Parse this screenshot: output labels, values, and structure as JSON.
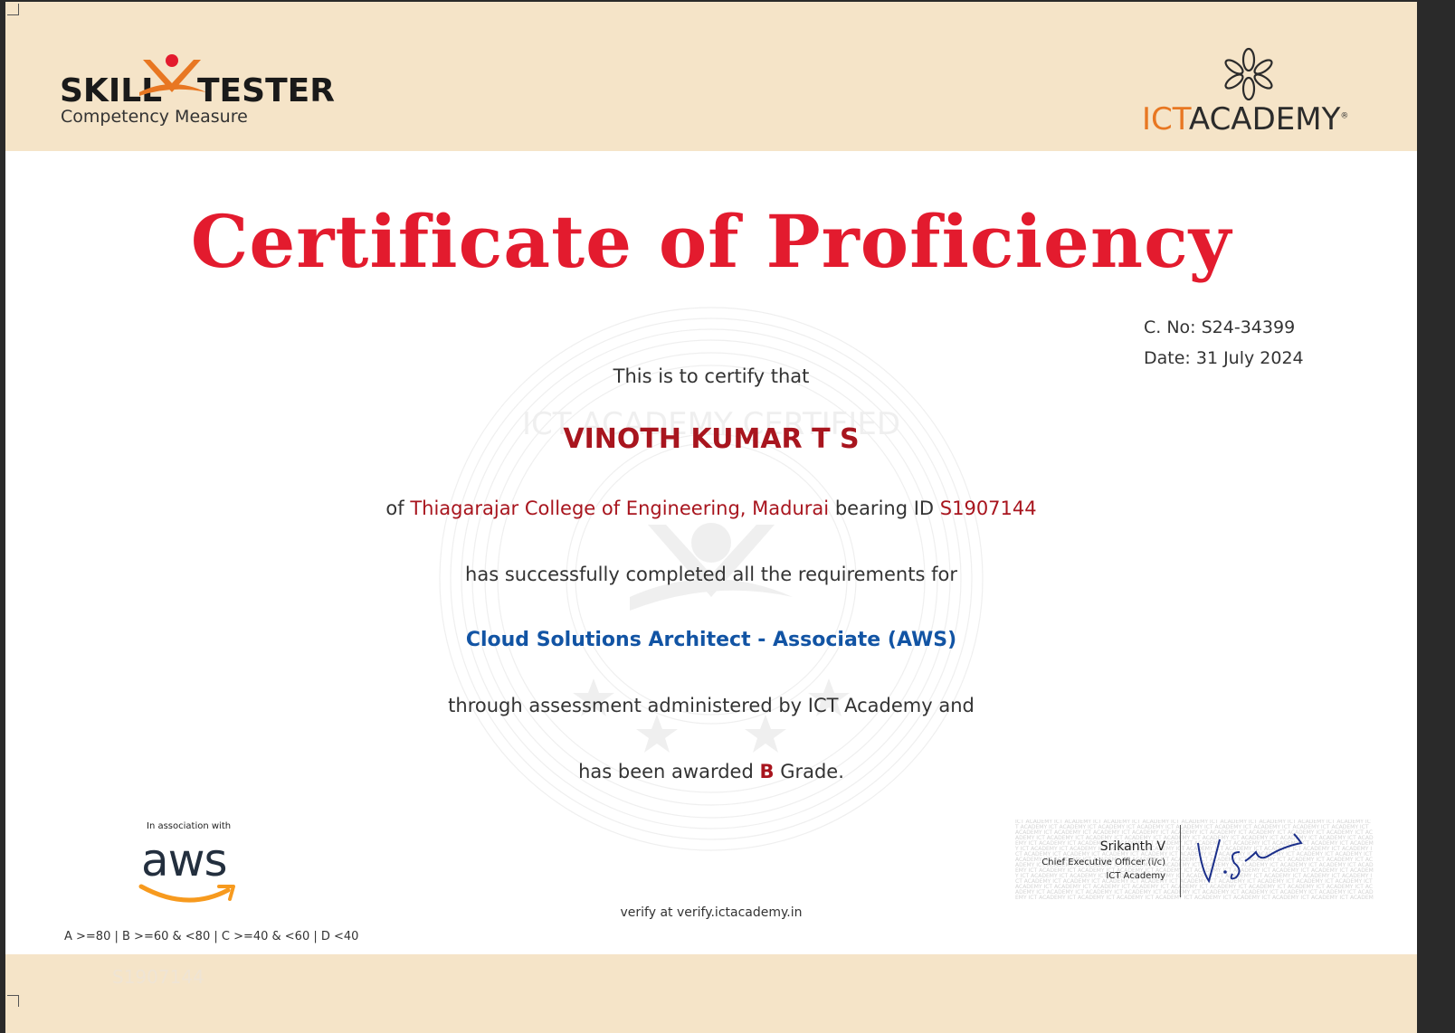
{
  "header": {
    "skill_tester": {
      "word_left": "SKILL",
      "word_right": "TESTER",
      "tagline": "Competency Measure",
      "brand_color": "#e87722"
    },
    "ict_academy": {
      "word_orange": "ICT",
      "word_dark": "ACADEMY",
      "registered": "®"
    }
  },
  "certificate": {
    "title": "Certificate of Proficiency",
    "certificate_no": "C. No: S24-34399",
    "date": "Date: 31 July 2024",
    "intro": "This is to certify that",
    "recipient_name": "VINOTH KUMAR T S",
    "of_prefix": "of",
    "institution": "Thiagarajar College of Engineering, Madurai",
    "bearing_id_label": "bearing ID",
    "student_id": "S1907144",
    "completed_text": "has successfully completed all the requirements for",
    "course": "Cloud Solutions Architect - Associate (AWS)",
    "assessment_text": "through assessment administered by ICT Academy and",
    "awarded_prefix": "has been awarded",
    "grade": "B",
    "awarded_suffix": "Grade."
  },
  "footer": {
    "association_label": "In association with",
    "aws_word": "aws",
    "grade_legend": "A >=80  |  B >=60 & <80  | C >=40 & <60  |  D <40",
    "verify_text": "verify at verify.ictacademy.in",
    "signatory_name": "Srikanth V",
    "signatory_title": "Chief Executive Officer (i/c)",
    "signatory_org": "ICT Academy",
    "watermark_id": "S1907144",
    "signature_pattern_text": "ICT ACADEMY",
    "seal_text": "ICT ACADEMY CERTIFIED"
  },
  "colors": {
    "title_red": "#e31b2e",
    "accent_red": "#a8151e",
    "course_blue": "#1254a4",
    "band_beige": "#f5e4c8",
    "ict_orange": "#e87722",
    "aws_navy": "#232f3e",
    "aws_orange": "#f79a1e"
  }
}
